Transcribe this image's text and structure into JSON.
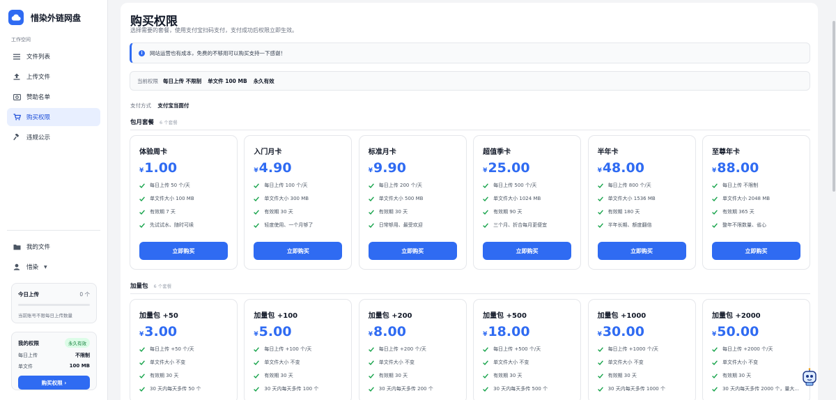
{
  "app": {
    "name": "惜染外链网盘",
    "workspace_label": "工作空间"
  },
  "sidebar": {
    "items": [
      {
        "label": "文件列表",
        "icon": "list-icon"
      },
      {
        "label": "上传文件",
        "icon": "upload-icon"
      },
      {
        "label": "赞助名单",
        "icon": "sponsor-icon"
      },
      {
        "label": "购买权限",
        "icon": "cart-icon",
        "active": true
      },
      {
        "label": "违规公示",
        "icon": "gavel-icon"
      }
    ],
    "my_files": "我的文件",
    "user": "惜染",
    "today": {
      "label": "今日上传",
      "count": "0 个",
      "progress": 0,
      "note": "当前账号不限每日上传数量"
    },
    "perm": {
      "label": "我的权限",
      "badge": "永久有效",
      "daily_label": "每日上传",
      "daily_value": "不限制",
      "size_label": "单文件",
      "size_value": "100 MB",
      "button": "购买权限 ›"
    }
  },
  "main": {
    "title": "购买权限",
    "subtitle": "选择需要的套餐，使用支付宝扫码支付，支付成功后权限立即生效。",
    "notice": "网站运营也有成本，免费的不够用可以购买支持一下感谢！",
    "current": {
      "label": "当前权限",
      "daily": "每日上传 不限制",
      "size": "单文件 100 MB",
      "validity": "永久有效"
    },
    "pay": {
      "label": "支付方式",
      "value": "支付宝当面付"
    },
    "monthly": {
      "title": "包月套餐",
      "count": "6 个套餐",
      "cards": [
        {
          "name": "体验周卡",
          "currency": "¥",
          "price": "1.00",
          "features": [
            "每日上传 50 个/天",
            "单文件大小 100 MB",
            "有效期 7 天",
            "先试试水、随时可续"
          ],
          "button": "立即购买"
        },
        {
          "name": "入门月卡",
          "currency": "¥",
          "price": "4.90",
          "features": [
            "每日上传 100 个/天",
            "单文件大小 300 MB",
            "有效期 30 天",
            "轻度使用、一个月够了"
          ],
          "button": "立即购买"
        },
        {
          "name": "标准月卡",
          "currency": "¥",
          "price": "9.90",
          "features": [
            "每日上传 200 个/天",
            "单文件大小 500 MB",
            "有效期 30 天",
            "日常够用、最受欢迎"
          ],
          "button": "立即购买"
        },
        {
          "name": "超值季卡",
          "currency": "¥",
          "price": "25.00",
          "features": [
            "每日上传 500 个/天",
            "单文件大小 1024 MB",
            "有效期 90 天",
            "三个月、折合每月更便宜"
          ],
          "button": "立即购买"
        },
        {
          "name": "半年卡",
          "currency": "¥",
          "price": "48.00",
          "features": [
            "每日上传 800 个/天",
            "单文件大小 1536 MB",
            "有效期 180 天",
            "半年长期、额度翻倍"
          ],
          "button": "立即购买"
        },
        {
          "name": "至尊年卡",
          "currency": "¥",
          "price": "88.00",
          "features": [
            "每日上传 不限制",
            "单文件大小 2048 MB",
            "有效期 365 天",
            "整年不限数量、省心"
          ],
          "button": "立即购买"
        }
      ]
    },
    "addon": {
      "title": "加量包",
      "count": "6 个套餐",
      "cards": [
        {
          "name": "加量包 +50",
          "currency": "¥",
          "price": "3.00",
          "features": [
            "每日上传 +50 个/天",
            "单文件大小 不变",
            "有效期 30 天",
            "30 天内每天多传 50 个"
          ]
        },
        {
          "name": "加量包 +100",
          "currency": "¥",
          "price": "5.00",
          "features": [
            "每日上传 +100 个/天",
            "单文件大小 不变",
            "有效期 30 天",
            "30 天内每天多传 100 个"
          ]
        },
        {
          "name": "加量包 +200",
          "currency": "¥",
          "price": "8.00",
          "features": [
            "每日上传 +200 个/天",
            "单文件大小 不变",
            "有效期 30 天",
            "30 天内每天多传 200 个"
          ]
        },
        {
          "name": "加量包 +500",
          "currency": "¥",
          "price": "18.00",
          "features": [
            "每日上传 +500 个/天",
            "单文件大小 不变",
            "有效期 30 天",
            "30 天内每天多传 500 个"
          ]
        },
        {
          "name": "加量包 +1000",
          "currency": "¥",
          "price": "30.00",
          "features": [
            "每日上传 +1000 个/天",
            "单文件大小 不变",
            "有效期 30 天",
            "30 天内每天多传 1000 个"
          ]
        },
        {
          "name": "加量包 +2000",
          "currency": "¥",
          "price": "50.00",
          "features": [
            "每日上传 +2000 个/天",
            "单文件大小 不变",
            "有效期 30 天",
            "30 天内每天多传 2000 个，量大..."
          ]
        }
      ]
    }
  },
  "colors": {
    "accent": "#2f6bf2",
    "check": "#16a34a",
    "active_bg": "#e8efff"
  }
}
